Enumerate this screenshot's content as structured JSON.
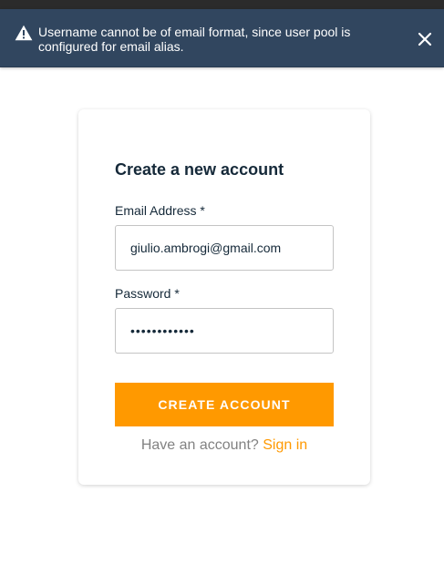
{
  "toast": {
    "message": "Username cannot be of email format, since user pool is configured for email alias.",
    "icon": "warning-icon",
    "close_icon": "close-icon",
    "background": "#31465f"
  },
  "signup": {
    "title": "Create a new account",
    "email_label": "Email Address *",
    "email_value": "giulio.ambrogi@gmail.com",
    "password_label": "Password *",
    "password_value": "••••••••••••",
    "submit_label": "CREATE ACCOUNT",
    "have_account_text": "Have an account?",
    "sign_in_label": "Sign in"
  },
  "colors": {
    "accent": "#ff9900",
    "text": "#152939",
    "muted": "#828282"
  }
}
